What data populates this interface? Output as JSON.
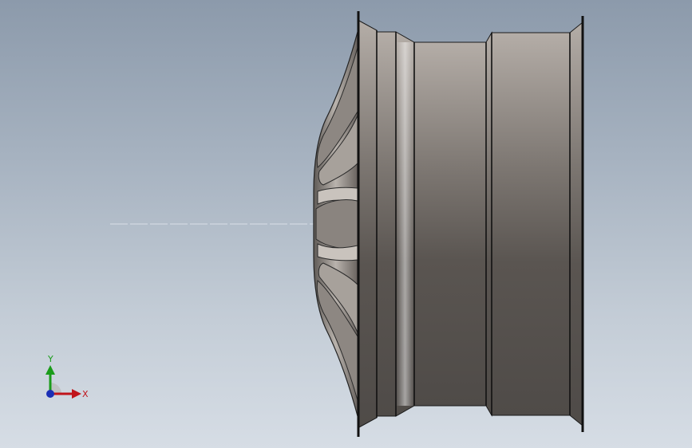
{
  "viewport": {
    "background_top": "#8c9aab",
    "background_bottom": "#d6dde5"
  },
  "model": {
    "name": "wheel-rim",
    "body_color": "#6e6a66",
    "highlight_color": "#d9d6d2",
    "edge_color": "#111111"
  },
  "triad": {
    "x_label": "X",
    "y_label": "Y",
    "x_color": "#c0141b",
    "y_color": "#1a9c1a",
    "z_color": "#1b2fb5"
  }
}
